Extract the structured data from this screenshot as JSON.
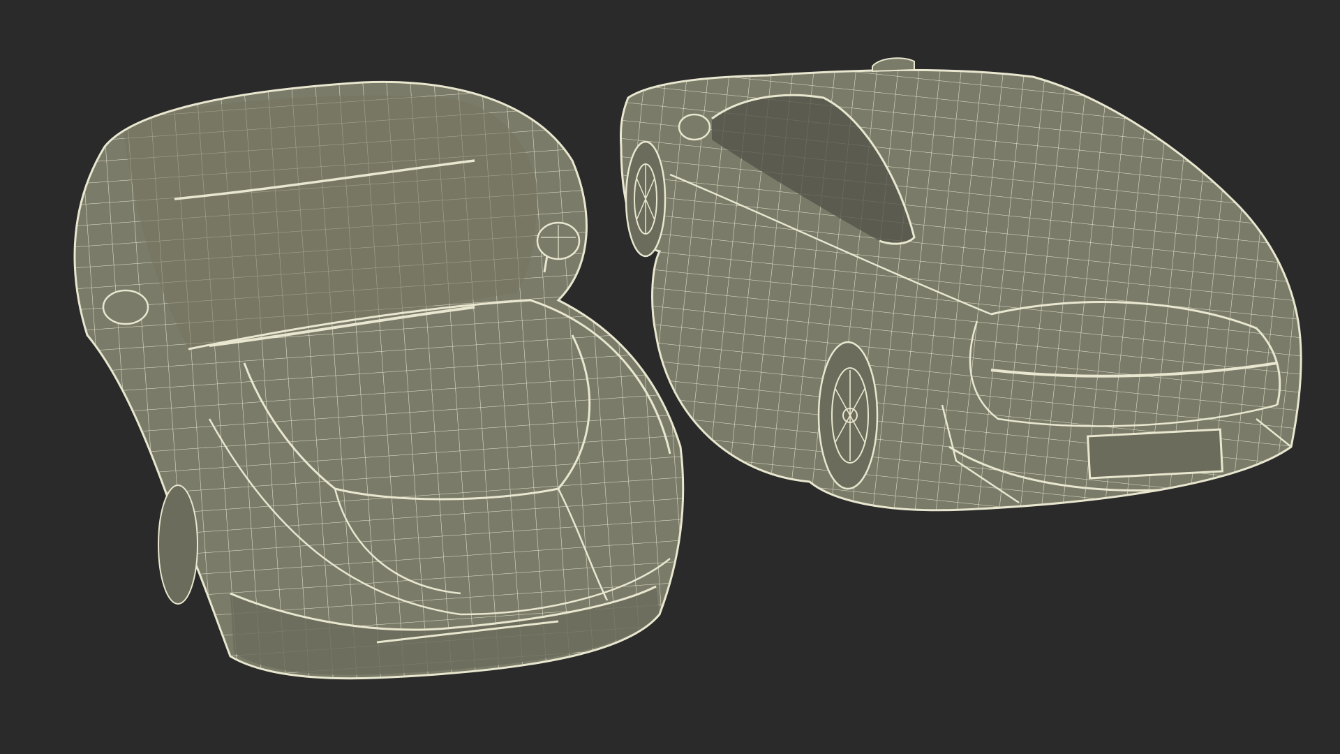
{
  "scene": {
    "background_color": "#2a2a2a",
    "body_color": "#7b7b6a",
    "body_shade_color": "#6c6c5c",
    "wire_color": "#e9e7cf",
    "wire_dark_color": "#3a3a33"
  }
}
